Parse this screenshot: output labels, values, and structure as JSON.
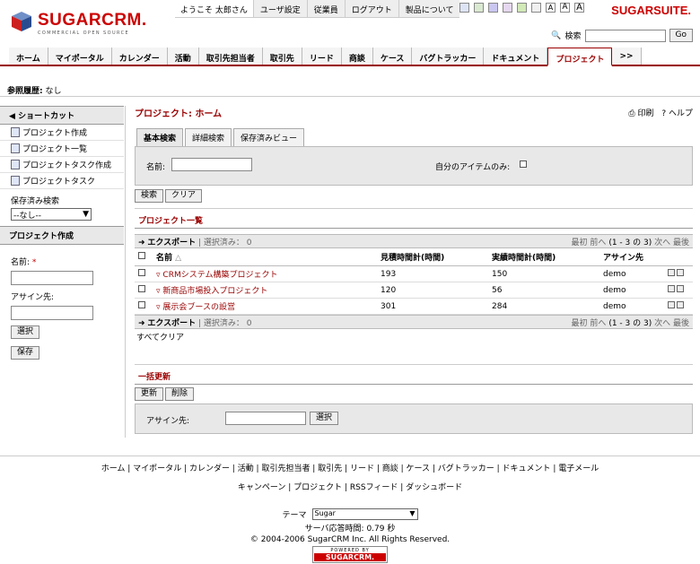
{
  "brand": {
    "name": "SUGARCRM.",
    "tagline": "COMMERCIAL OPEN SOURCE",
    "suite": "SUGARSUITE."
  },
  "topbar": {
    "welcome": "ようこそ 太郎さん",
    "links": [
      "ユーザ設定",
      "従業員",
      "ログアウト",
      "製品について"
    ],
    "theme_colors": [
      "#dde4f5",
      "#d9e9d0",
      "#c9c6f0",
      "#e5d7ef",
      "#d2e9b8",
      "#f0f0f0"
    ],
    "font_sizes": [
      "A",
      "A",
      "A"
    ]
  },
  "search": {
    "label": "検索",
    "button": "Go"
  },
  "tabs": [
    "ホーム",
    "マイポータル",
    "カレンダー",
    "活動",
    "取引先担当者",
    "取引先",
    "リード",
    "商談",
    "ケース",
    "バグトラッカー",
    "ドキュメント",
    "プロジェクト",
    ">>"
  ],
  "active_tab": "プロジェクト",
  "breadcrumb": {
    "label": "参照履歴:",
    "value": "なし"
  },
  "shortcuts": {
    "title": "ショートカット",
    "items": [
      "プロジェクト作成",
      "プロジェクト一覧",
      "プロジェクトタスク作成",
      "プロジェクトタスク"
    ],
    "saved_search_label": "保存済み検索",
    "saved_search_value": "--なし--"
  },
  "quick_create": {
    "title": "プロジェクト作成",
    "name_label": "名前:",
    "required": "*",
    "assign_label": "アサイン先:",
    "select_button": "選択",
    "save_button": "保存"
  },
  "main": {
    "title": "プロジェクト: ホーム",
    "print": "印刷",
    "help": "ヘルプ"
  },
  "search_tabs": [
    "基本検索",
    "詳細検索",
    "保存済みビュー"
  ],
  "search_form": {
    "name_label": "名前:",
    "mine_label": "自分のアイテムのみ:",
    "search_button": "検索",
    "clear_button": "クリア"
  },
  "list": {
    "title": "プロジェクト一覧",
    "export": "エクスポート",
    "selected": "| 選択済み： 0",
    "pager": {
      "first": "最初",
      "prev": "前へ",
      "range": "(1 - 3 の 3)",
      "next": "次へ",
      "last": "最後"
    },
    "columns": [
      "名前",
      "見積時間計(時間)",
      "実績時間計(時間)",
      "アサイン先"
    ],
    "rows": [
      [
        "CRMシステム構築プロジェクト",
        "193",
        "150",
        "demo"
      ],
      [
        "新商品市場投入プロジェクト",
        "120",
        "56",
        "demo"
      ],
      [
        "展示会ブースの設営",
        "301",
        "284",
        "demo"
      ]
    ],
    "clear_all": "すべてクリア"
  },
  "mass_update": {
    "title": "一括更新",
    "update_button": "更新",
    "delete_button": "削除",
    "assign_label": "アサイン先:",
    "select_button": "選択"
  },
  "footer": {
    "links1": "ホーム | マイポータル | カレンダー | 活動 | 取引先担当者 | 取引先 | リード | 商談 | ケース | バグトラッカー | ドキュメント | 電子メール",
    "links2": "キャンペーン | プロジェクト | RSSフィード | ダッシュボード",
    "theme_label": "テーマ",
    "theme_value": "Sugar",
    "response": "サーバ応答時間: 0.79 秒",
    "copyright": "© 2004-2006 SugarCRM Inc. All Rights Reserved.",
    "powered_by": "POWERED BY",
    "powered_logo": "SUGARCRM."
  }
}
